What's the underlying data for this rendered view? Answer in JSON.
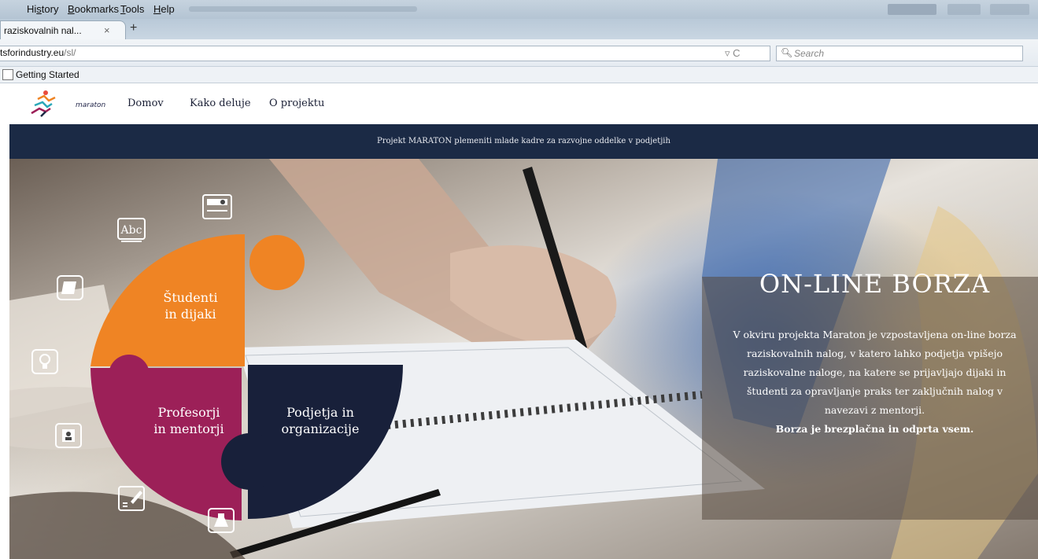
{
  "browser": {
    "menu": [
      {
        "pre": "Hi",
        "u": "s",
        "post": "tory"
      },
      {
        "pre": "",
        "u": "B",
        "post": "ookmarks"
      },
      {
        "pre": "",
        "u": "T",
        "post": "ools"
      },
      {
        "pre": "",
        "u": "H",
        "post": "elp"
      }
    ],
    "tab_title": "raziskovalnih nal...",
    "tab_close": "×",
    "new_tab": "+",
    "url_host": "tsforindustry.eu",
    "url_path": "/sl/",
    "url_icons": "▿ C",
    "search_placeholder": "Search",
    "search_icon": "magnifier-icon",
    "bookmark": "Getting Started"
  },
  "site": {
    "logo_text": "maraton",
    "nav": [
      "Domov",
      "Kako deluje",
      "O projektu"
    ],
    "tagline": "Projekt MARATON plemeniti mlade kadre za razvojne oddelke v podjetjih",
    "hero_title": "ON-LINE BORZA",
    "hero_body": "V okviru projekta Maraton je vzpostavljena on-line borza raziskovalnih nalog, v katero lahko podjetja vpišejo raziskovalne naloge, na katere se prijavljajo dijaki in študenti za opravljanje praks ter zaključnih nalog v navezavi z mentorji.",
    "hero_bold": "Borza je brezplačna in odprta vsem.",
    "puzzle": {
      "orange": {
        "line1": "Študenti",
        "line2": "in dijaki",
        "color": "#ef8424"
      },
      "purple": {
        "line1": "Profesorji",
        "line2": "in mentorji",
        "color": "#9c2058"
      },
      "navy": {
        "line1": "Podjetja in",
        "line2": "organizacije",
        "color": "#18203a"
      }
    },
    "icons": {
      "abc": "Abc",
      "set": [
        "abc-card-icon",
        "id-card-icon",
        "book-icon",
        "lightbulb-icon",
        "badge-icon",
        "certificate-pen-icon",
        "flask-icon"
      ]
    }
  }
}
